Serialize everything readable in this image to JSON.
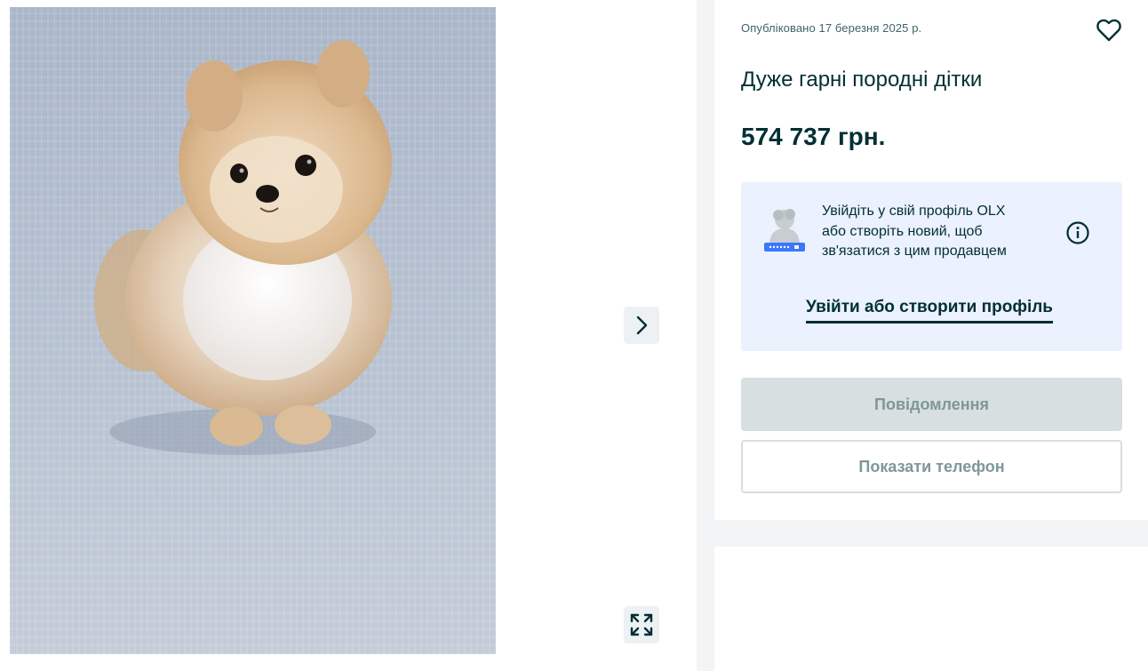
{
  "gallery": {
    "photo_subject": "pomeranian-puppy-photo",
    "next_icon": "chevron-right-icon",
    "fullscreen_icon": "expand-icon"
  },
  "listing": {
    "published": "Опубліковано 17 березня 2025 р.",
    "title": "Дуже гарні породні дітки",
    "price": "574 737 грн.",
    "favorite_icon": "heart-icon"
  },
  "login_prompt": {
    "lines": [
      "Увійдіть у свій профіль OLX",
      "або створіть новий, щоб",
      "зв'язатися з цим продавцем"
    ],
    "link": "Увійти або створити профіль",
    "info_icon": "info-icon"
  },
  "actions": {
    "message_label": "Повідомлення",
    "phone_label": "Показати телефон"
  },
  "colors": {
    "brand_dark": "#002f34",
    "login_box_bg": "#ebf1fd",
    "disabled_button": "#d8dfe0",
    "disabled_text": "#7f9799",
    "page_bg": "#f2f4f5"
  }
}
